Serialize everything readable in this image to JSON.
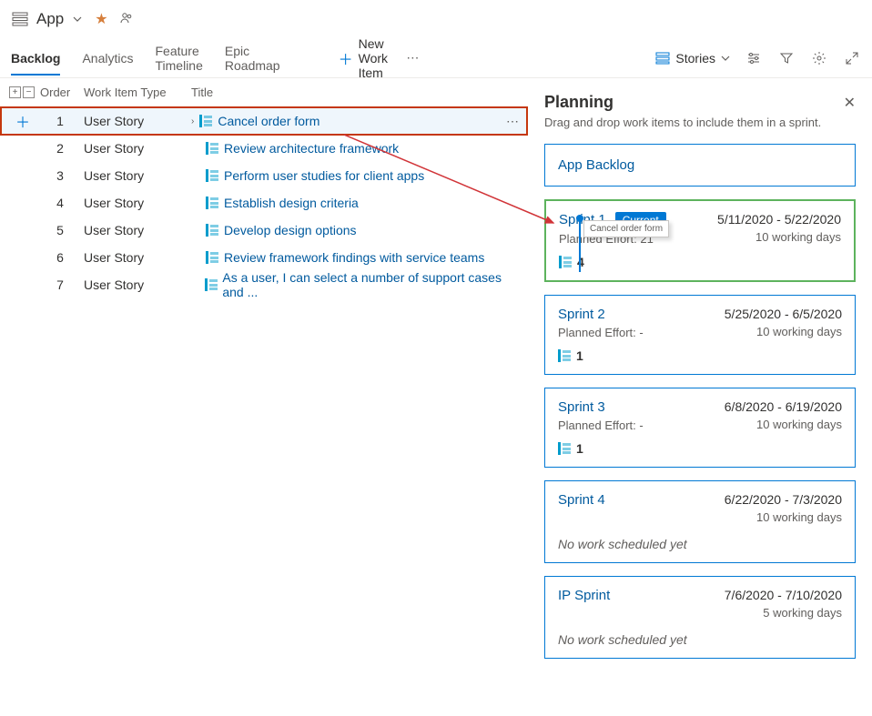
{
  "header": {
    "app_name": "App",
    "favorited": true
  },
  "tabs": {
    "items": [
      "Backlog",
      "Analytics",
      "Feature Timeline",
      "Epic Roadmap"
    ],
    "active": "Backlog"
  },
  "toolbar": {
    "new_work_item": "New Work Item",
    "view_selector": "Stories"
  },
  "columns": {
    "order": "Order",
    "type": "Work Item Type",
    "title": "Title"
  },
  "backlog": [
    {
      "order": 1,
      "type": "User Story",
      "title": "Cancel order form",
      "selected": true,
      "expandable": true
    },
    {
      "order": 2,
      "type": "User Story",
      "title": "Review architecture framework"
    },
    {
      "order": 3,
      "type": "User Story",
      "title": "Perform user studies for client apps"
    },
    {
      "order": 4,
      "type": "User Story",
      "title": "Establish design criteria"
    },
    {
      "order": 5,
      "type": "User Story",
      "title": "Develop design options"
    },
    {
      "order": 6,
      "type": "User Story",
      "title": "Review framework findings with service teams"
    },
    {
      "order": 7,
      "type": "User Story",
      "title": "As a user, I can select a number of support cases and ..."
    }
  ],
  "planning": {
    "title": "Planning",
    "subtitle": "Drag and drop work items to include them in a sprint.",
    "backlog_card": "App Backlog",
    "drag_item": "Cancel order form",
    "current_label": "Current",
    "no_work_label": "No work scheduled yet",
    "sprints": [
      {
        "name": "Sprint 1",
        "dates": "5/11/2020 - 5/22/2020",
        "working": "10 working days",
        "effort": "Planned Effort: 21",
        "count": 4,
        "current": true
      },
      {
        "name": "Sprint 2",
        "dates": "5/25/2020 - 6/5/2020",
        "working": "10 working days",
        "effort": "Planned Effort: -",
        "count": 1
      },
      {
        "name": "Sprint 3",
        "dates": "6/8/2020 - 6/19/2020",
        "working": "10 working days",
        "effort": "Planned Effort: -",
        "count": 1
      },
      {
        "name": "Sprint 4",
        "dates": "6/22/2020 - 7/3/2020",
        "working": "10 working days",
        "no_work": true
      },
      {
        "name": "IP Sprint",
        "dates": "7/6/2020 - 7/10/2020",
        "working": "5 working days",
        "no_work": true
      }
    ]
  }
}
